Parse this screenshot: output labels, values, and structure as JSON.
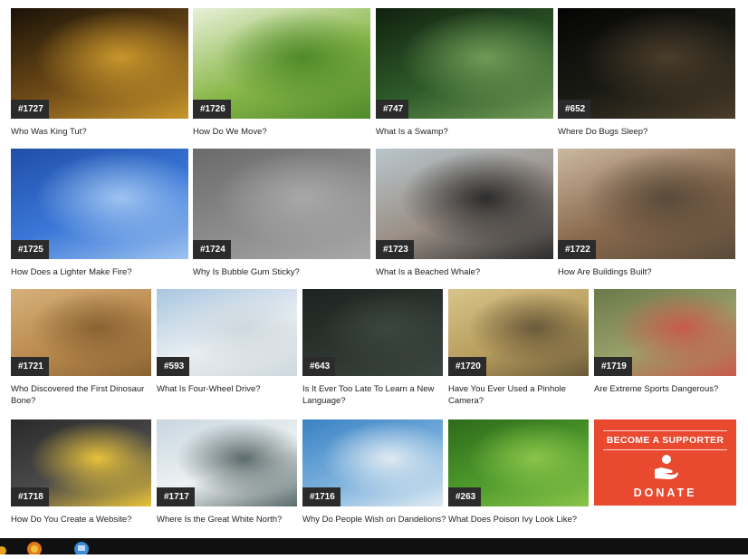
{
  "colors": {
    "accent": "#e8492f",
    "badge": "#2b2b2b",
    "text": "#222222",
    "taskbar": "#101010"
  },
  "cards": [
    {
      "num": "#1727",
      "title": "Who Was King Tut?",
      "image": "golden-pharaoh-mask",
      "colors": [
        "#1a1208",
        "#6e4a17",
        "#c8962c"
      ]
    },
    {
      "num": "#1726",
      "title": "How Do We Move?",
      "image": "children-running-on-grass",
      "colors": [
        "#e8f0d8",
        "#8ab84a",
        "#4f8a2a"
      ]
    },
    {
      "num": "#747",
      "title": "What Is a Swamp?",
      "image": "cypress-swamp-trees",
      "colors": [
        "#11210f",
        "#2e5a2a",
        "#6f9a55"
      ]
    },
    {
      "num": "#652",
      "title": "Where Do Bugs Sleep?",
      "image": "lanternfly-insect-on-bark",
      "colors": [
        "#050505",
        "#1a1a14",
        "#4a3d2a"
      ]
    },
    {
      "num": "#1725",
      "title": "How Does a Lighter Make Fire?",
      "image": "hand-sparking-lighter",
      "colors": [
        "#1f4fa8",
        "#3b78d8",
        "#9ec3f0"
      ]
    },
    {
      "num": "#1724",
      "title": "Why Is Bubble Gum Sticky?",
      "image": "girl-blowing-bubble-gum",
      "colors": [
        "#6a6a6a",
        "#8c8c8c",
        "#a8a8a8"
      ]
    },
    {
      "num": "#1723",
      "title": "What Is a Beached Whale?",
      "image": "people-with-beached-whale",
      "colors": [
        "#b9c6cc",
        "#9a8f86",
        "#2c2c2c"
      ]
    },
    {
      "num": "#1722",
      "title": "How Are Buildings Built?",
      "image": "engineer-at-construction-site",
      "colors": [
        "#cbb8a0",
        "#8a6a4e",
        "#5a4a3a"
      ]
    },
    {
      "num": "#1721",
      "title": "Who Discovered the First Dinosaur Bone?",
      "image": "dinosaur-fossil-dig",
      "colors": [
        "#d6b07a",
        "#b98a4e",
        "#8a6232"
      ]
    },
    {
      "num": "#593",
      "title": "What Is Four-Wheel Drive?",
      "image": "jeep-in-snow",
      "colors": [
        "#a9c6e0",
        "#e8eef2",
        "#cfd8de"
      ]
    },
    {
      "num": "#643",
      "title": "Is It Ever Too Late To Learn a New Language?",
      "image": "girl-at-chalkboard",
      "colors": [
        "#1d2320",
        "#2d3530",
        "#3c4640"
      ]
    },
    {
      "num": "#1720",
      "title": "Have You Ever Used a Pinhole Camera?",
      "image": "vintage-camera",
      "colors": [
        "#d8c48a",
        "#b89e5e",
        "#6a5a3a"
      ]
    },
    {
      "num": "#1719",
      "title": "Are Extreme Sports Dangerous?",
      "image": "climbers-helping-hand",
      "colors": [
        "#6a7a4a",
        "#9aa06a",
        "#c85a4a"
      ]
    },
    {
      "num": "#1718",
      "title": "How Do You Create a Website?",
      "image": "keyboard-website-key",
      "colors": [
        "#2a2a2a",
        "#4a4a4a",
        "#e8c23a"
      ]
    },
    {
      "num": "#1717",
      "title": "Where Is the Great White North?",
      "image": "snowy-forest-river",
      "colors": [
        "#c8d6e0",
        "#eef2f4",
        "#5a6a6a"
      ]
    },
    {
      "num": "#1716",
      "title": "Why Do People Wish on Dandelions?",
      "image": "dandelion-seed-head",
      "colors": [
        "#3a82c4",
        "#7ab0dc",
        "#dfeaf2"
      ]
    },
    {
      "num": "#263",
      "title": "What Does Poison Ivy Look Like?",
      "image": "poison-ivy-leaves",
      "colors": [
        "#2d6a1a",
        "#4e9a2c",
        "#8ac44a"
      ]
    }
  ],
  "donate": {
    "heading": "BECOME A SUPPORTER",
    "button": "DONATE"
  }
}
